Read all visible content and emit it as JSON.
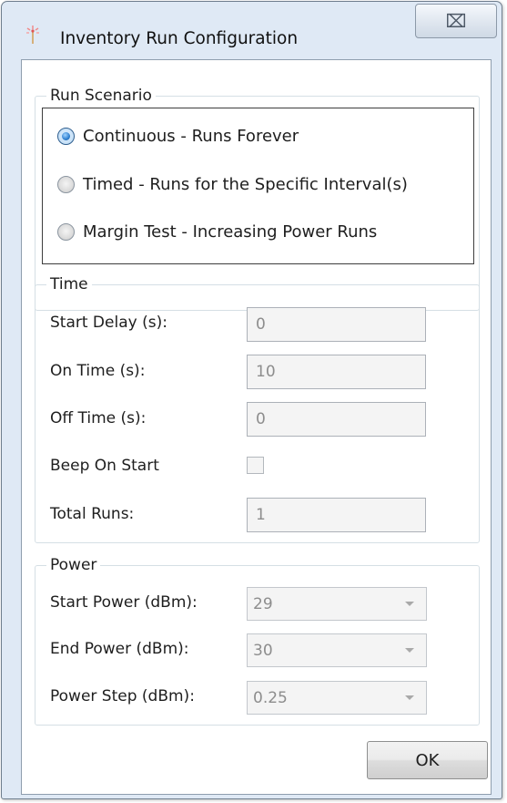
{
  "window": {
    "title": "Inventory Run Configuration",
    "icon": "antenna-icon",
    "close_glyph": "⌧"
  },
  "run_scenario": {
    "legend": "Run Scenario",
    "options": [
      {
        "label": "Continuous - Runs Forever",
        "selected": true
      },
      {
        "label": "Timed - Runs for the Specific Interval(s)",
        "selected": false
      },
      {
        "label": "Margin Test - Increasing Power Runs",
        "selected": false
      }
    ]
  },
  "time": {
    "legend": "Time",
    "start_delay": {
      "label": "Start Delay (s):",
      "value": "0"
    },
    "on_time": {
      "label": "On Time (s):",
      "value": "10"
    },
    "off_time": {
      "label": "Off Time (s):",
      "value": "0"
    },
    "beep_on_start": {
      "label": "Beep On Start",
      "checked": false
    },
    "total_runs": {
      "label": "Total Runs:",
      "value": "1"
    }
  },
  "power": {
    "legend": "Power",
    "start_power": {
      "label": "Start Power (dBm):",
      "value": "29"
    },
    "end_power": {
      "label": "End Power (dBm):",
      "value": "30"
    },
    "power_step": {
      "label": "Power Step (dBm):",
      "value": "0.25"
    }
  },
  "buttons": {
    "ok": "OK"
  },
  "colors": {
    "window_frame": "#dfe9f5",
    "client_background": "#ffffff",
    "group_border": "#d5dfe5",
    "disabled_text": "#8d8d8d",
    "radio_selected": "#2d7fd0"
  }
}
